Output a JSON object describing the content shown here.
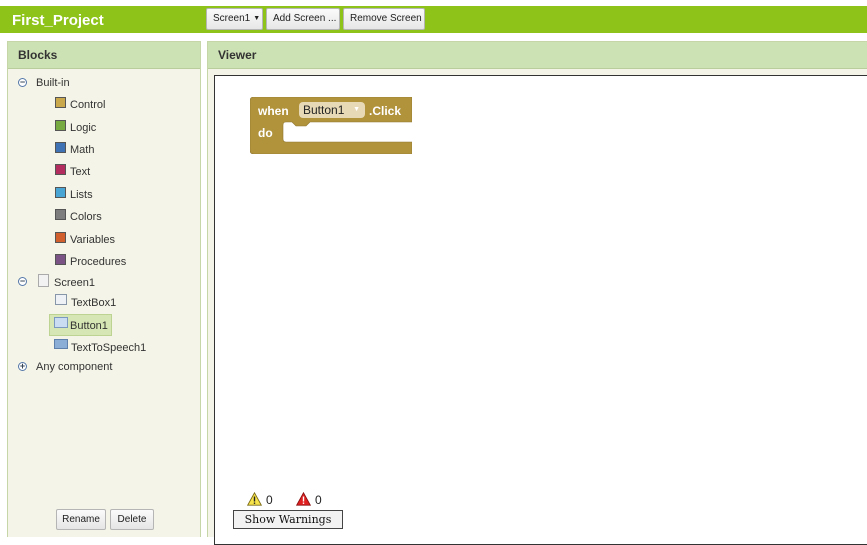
{
  "project": {
    "title": "First_Project"
  },
  "toolbar": {
    "screen_selector": "Screen1",
    "add_screen": "Add Screen ...",
    "remove_screen": "Remove Screen"
  },
  "blocks_panel": {
    "header": "Blocks",
    "builtin": {
      "label": "Built-in",
      "items": [
        {
          "label": "Control",
          "color": "#c9a84c"
        },
        {
          "label": "Logic",
          "color": "#77ab41"
        },
        {
          "label": "Math",
          "color": "#3f71b5"
        },
        {
          "label": "Text",
          "color": "#b32d5e"
        },
        {
          "label": "Lists",
          "color": "#49a6d4"
        },
        {
          "label": "Colors",
          "color": "#7d7d7d"
        },
        {
          "label": "Variables",
          "color": "#d05f2d"
        },
        {
          "label": "Procedures",
          "color": "#7c5385"
        }
      ]
    },
    "screen": {
      "label": "Screen1",
      "components": [
        {
          "label": "TextBox1",
          "icon": "textbox-icon"
        },
        {
          "label": "Button1",
          "icon": "button-icon",
          "selected": true
        },
        {
          "label": "TextToSpeech1",
          "icon": "speech-icon"
        }
      ]
    },
    "any_component": "Any component",
    "rename_button": "Rename",
    "delete_button": "Delete"
  },
  "viewer": {
    "header": "Viewer",
    "event_block": {
      "when": "when",
      "component": "Button1",
      "event": ".Click",
      "do": "do",
      "color": "#b1933c"
    },
    "warnings": {
      "warning_count": "0",
      "error_count": "0",
      "show_warnings_label": "Show Warnings"
    }
  }
}
